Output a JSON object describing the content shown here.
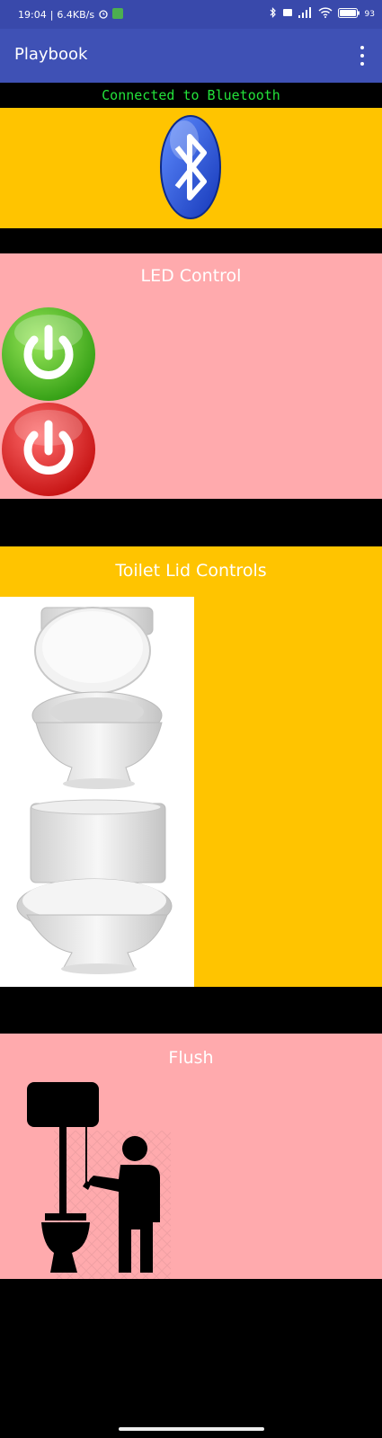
{
  "status_bar": {
    "time": "19:04",
    "speed": "6.4KB/s",
    "battery": "93"
  },
  "app_bar": {
    "title": "Playbook",
    "menu_icon": "more-vert-icon"
  },
  "connection_status": "Connected to Bluetooth",
  "bluetooth_panel": {
    "icon": "bluetooth-icon"
  },
  "led_panel": {
    "title": "LED Control",
    "on_button_icon": "power-on-icon",
    "off_button_icon": "power-off-icon"
  },
  "lid_panel": {
    "title": "Toilet Lid Controls",
    "image": "toilet-lid-image"
  },
  "flush_panel": {
    "title": "Flush",
    "image": "flush-image"
  },
  "colors": {
    "status_bar": "#3949ab",
    "app_bar": "#3f51b5",
    "connection_text": "#23e23a",
    "yellow_panel": "#ffc400",
    "pink_panel": "#ffaaad"
  }
}
